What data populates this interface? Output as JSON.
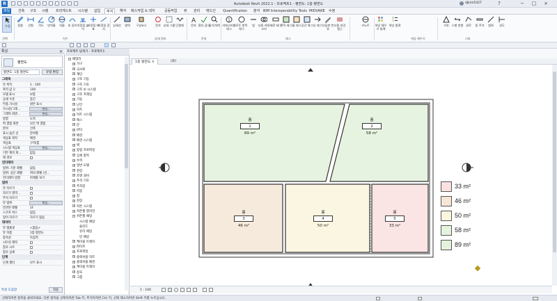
{
  "app": {
    "title": "Autodesk Revit 2022.1 - 프로젝트1 - 평면도: 1층 평면도",
    "user": "djkim5427"
  },
  "menu": {
    "tabs": [
      "파일",
      "건축",
      "구조",
      "시템",
      "프리캐스트",
      "시스템",
      "삽입",
      "주석",
      "해석",
      "매스작업 & 대지",
      "공동작업",
      "뷰",
      "관리",
      "애드인",
      "Quantification",
      "분석",
      "BIM Interoperability Tools",
      "MIDVARE",
      "수정"
    ]
  },
  "ribbon": {
    "buttons": [
      "수정",
      "정렬",
      "선형",
      "각도",
      "반지름",
      "지름",
      "호 길이",
      "지정점 높이",
      "지정점 좌표",
      "지정점 경사",
      "상세선",
      "영역",
      "구성요소",
      "문자",
      "상세 그룹",
      "단열재",
      "문자",
      "철자 검사",
      "찾기/대치",
      "카테고리별 태그",
      "모든 항목 태그",
      "빔",
      "다중 카테고리",
      "재료 태그",
      "면적 태그",
      "룸 태그",
      "공간 태그",
      "뷰 태그",
      "다딤판 번호",
      "다중 보강 철근",
      "키노트",
      "색상 채우기 범례",
      "색상 범례",
      "기호",
      "스팬 방향",
      "경로",
      "빔 주석",
      "범위",
      "강도"
    ],
    "panels": [
      "선택",
      "치수",
      "상세 정보",
      "문자",
      "태그",
      "색상 채우기",
      "기호"
    ]
  },
  "properties": {
    "header": "특성",
    "type_name": "평면도",
    "view_selector": "평면도: 1층 평면도",
    "edit_type": "유형 편집",
    "sections": [
      {
        "title": "그래픽",
        "rows": [
          [
            "뷰 축척",
            "1 : 100"
          ],
          [
            "축척 값 1:",
            "100"
          ],
          [
            "모델 표시",
            "보통"
          ],
          [
            "상세 수준",
            "중간"
          ],
          [
            "부품 가시성",
            "원본 표시"
          ],
          [
            "가시성/그래...",
            "편집..."
          ],
          [
            "그래픽 화면...",
            "편집..."
          ],
          [
            "방향",
            "도북"
          ],
          [
            "벽 결합 화면",
            "모든 벽 결합"
          ],
          [
            "분야",
            "건축"
          ],
          [
            "표시 숨은 선",
            "분야별"
          ],
          [
            "색상표 위치",
            "배경"
          ],
          [
            "색상표",
            "구역/룸"
          ],
          [
            "시스템 색상표",
            "편집..."
          ],
          [
            "기본 해석 화...",
            "없음"
          ],
          [
            "해 경로",
            ""
          ]
        ]
      },
      {
        "title": "언더레이",
        "rows": [
          [
            "범위: 기준 레벨",
            "없음"
          ],
          [
            "범위: 상단 레벨",
            "위의 레벨 (건..."
          ],
          [
            "언더레이 방향",
            "아래를 보기"
          ]
        ]
      },
      {
        "title": "범위",
        "rows": [
          [
            "뷰 자르기",
            ""
          ],
          [
            "자르기 영역...",
            ""
          ],
          [
            "주석 자르기",
            ""
          ],
          [
            "뷰 범위",
            "편집..."
          ],
          [
            "연관된 레벨",
            "1F"
          ],
          [
            "스코프 박스",
            "없음"
          ],
          [
            "깊이 자르기",
            "자르기 없음"
          ]
        ]
      },
      {
        "title": "데이터",
        "rows": [
          [
            "뷰 템플릿",
            "<없음>"
          ],
          [
            "뷰 이름",
            "1층 평면도"
          ],
          [
            "종속성",
            "독립적"
          ],
          [
            "시트의 제목",
            ""
          ],
          [
            "참조 시트",
            ""
          ],
          [
            "참조 상세",
            ""
          ]
        ]
      },
      {
        "title": "단계",
        "rows": [
          [
            "단계 필터",
            "모두 표시"
          ]
        ]
      }
    ],
    "help": "특성 도움말",
    "apply": "적용"
  },
  "browser": {
    "header": "프로젝트 탐색기 - 프로젝트1",
    "items": [
      "패밀리",
      "가구",
      "곡사로",
      "계단",
      "구조 기둥",
      "구조 기초",
      "구조 보 시스템",
      "구조 프레임",
      "기둥",
      "난간",
      "덕트",
      "덕트 시스템",
      "매스",
      "문",
      "바닥",
      "배관",
      "배관 시스템",
      "벽",
      "봉합 프로파일",
      "상세 항목",
      "수목",
      "일반 모델",
      "천장",
      "조명 설비",
      "주석 기호",
      "주차장",
      "지붕",
      "창",
      "천장",
      "커튼 시스템",
      "커튼월 멀리언",
      "커튼월 패널",
      "시스템 패널",
      "솔리드",
      "유리 패널",
      "빈 패널",
      "케이블 트레이",
      "파이프",
      "프로파일",
      "플렉서블 덕트",
      "플렉서블 배관",
      "케이블 트레이",
      "창호",
      "그룹"
    ]
  },
  "view_tabs": [
    "1층 평면도",
    "(로)"
  ],
  "status": "선택하려면 항목을 클릭하세요. 다른 항목을 선택하려면 Tab 키, 추가하려면 Ctrl 키, 선택 해소하려면 Shift 키를 누르십시오.",
  "viewbar": {
    "scale": "1 : 100"
  },
  "rooms": [
    {
      "name": "룸",
      "number": "1",
      "area": "89 m²",
      "color": "#e6f3e0"
    },
    {
      "name": "룸",
      "number": "2",
      "area": "58 m²",
      "color": "#e6f3e0"
    },
    {
      "name": "룸",
      "number": "3",
      "area": "46 m²",
      "color": "#f6eadc"
    },
    {
      "name": "룸",
      "number": "4",
      "area": "50 m²",
      "color": "#fbf6e2"
    },
    {
      "name": "룸",
      "number": "5",
      "area": "33 m²",
      "color": "#fbe4e4"
    }
  ],
  "legend": [
    {
      "label": "33 m²",
      "color": "#fbe1e1"
    },
    {
      "label": "46 m²",
      "color": "#f6e6d6"
    },
    {
      "label": "50 m²",
      "color": "#fbf5dc"
    },
    {
      "label": "58 m²",
      "color": "#e6f3df"
    },
    {
      "label": "89 m²",
      "color": "#e4f2dc"
    }
  ]
}
